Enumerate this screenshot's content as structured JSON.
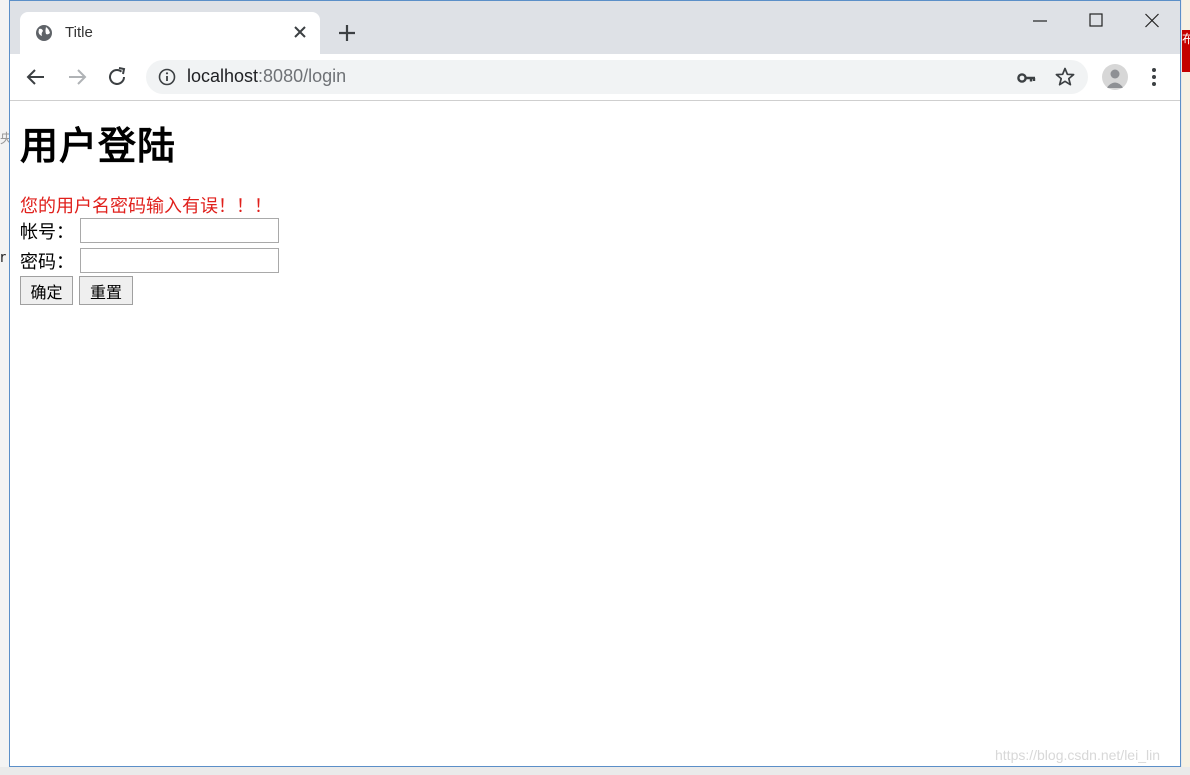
{
  "browser": {
    "tab_title": "Title",
    "url_host": "localhost",
    "url_rest": ":8080/login"
  },
  "icons": {
    "favicon": "globe-icon",
    "tab_close": "close-icon",
    "new_tab": "plus-icon",
    "minimize": "minimize-icon",
    "maximize": "maximize-icon",
    "close_window": "close-icon",
    "back": "arrow-left-icon",
    "forward": "arrow-right-icon",
    "reload": "reload-icon",
    "site_info": "info-icon",
    "password": "key-icon",
    "bookmark": "star-icon",
    "profile": "avatar-icon",
    "menu": "more-vertical-icon"
  },
  "page": {
    "heading": "用户登陆",
    "error": "您的用户名密码输入有误！！！",
    "username_label": "帐号：",
    "password_label": "密码：",
    "submit_label": "确定",
    "reset_label": "重置",
    "username_value": "",
    "password_value": ""
  },
  "watermark": "https://blog.csdn.net/lei_lin",
  "background": {
    "left_chars": [
      "央",
      "r"
    ],
    "right_chars": [
      "布"
    ]
  },
  "colors": {
    "error": "#e0201c",
    "titlebar": "#dee1e6",
    "window_border": "#5b8fc8"
  }
}
